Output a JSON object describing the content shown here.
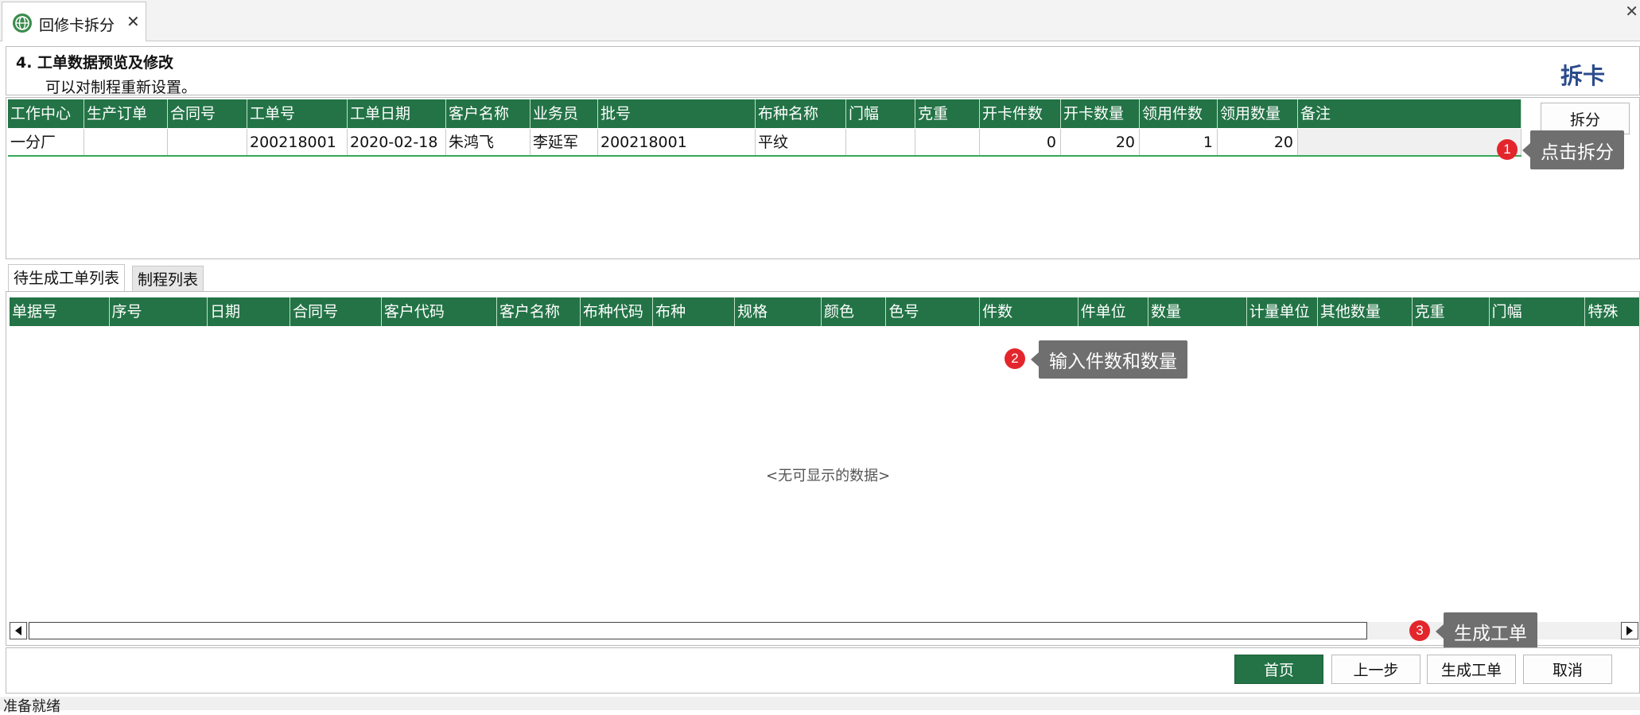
{
  "window": {
    "tab_title": "回修卡拆分",
    "tab_close": "✕",
    "close_glyph": "✕"
  },
  "step": {
    "title": "4.  工单数据预览及修改",
    "description": "可以对制程重新设置。",
    "heading": "拆卡"
  },
  "upper_grid": {
    "columns": [
      "工作中心",
      "生产订单",
      "合同号",
      "工单号",
      "工单日期",
      "客户名称",
      "业务员",
      "批号",
      "布种名称",
      "门幅",
      "克重",
      "开卡件数",
      "开卡数量",
      "领用件数",
      "领用数量",
      "备注"
    ],
    "rows": [
      [
        "一分厂",
        "",
        "",
        "200218001",
        "2020-02-18",
        "朱鸿飞",
        "李延军",
        "200218001",
        "平纹",
        "",
        "",
        "0",
        "20",
        "1",
        "20",
        ""
      ]
    ]
  },
  "split_button": "拆分",
  "callouts": [
    {
      "number": "1",
      "text": "点击拆分"
    },
    {
      "number": "2",
      "text": "输入件数和数量"
    },
    {
      "number": "3",
      "text": "生成工单"
    }
  ],
  "lower_tabs": [
    "待生成工单列表",
    "制程列表"
  ],
  "lower_grid": {
    "columns": [
      "单据号",
      "序号",
      "日期",
      "合同号",
      "客户代码",
      "客户名称",
      "布种代码",
      "布种",
      "规格",
      "颜色",
      "色号",
      "件数",
      "件单位",
      "数量",
      "计量单位",
      "其他数量",
      "克重",
      "门幅",
      "特殊"
    ],
    "empty_text": "<无可显示的数据>"
  },
  "buttons": {
    "home": "首页",
    "prev": "上一步",
    "generate": "生成工单",
    "cancel": "取消"
  },
  "status": "准备就绪",
  "colors": {
    "header_green": "#237346",
    "badge_red": "#e3262c",
    "callout_gray": "#6f6f6f",
    "heading_blue": "#2b4b8c"
  }
}
